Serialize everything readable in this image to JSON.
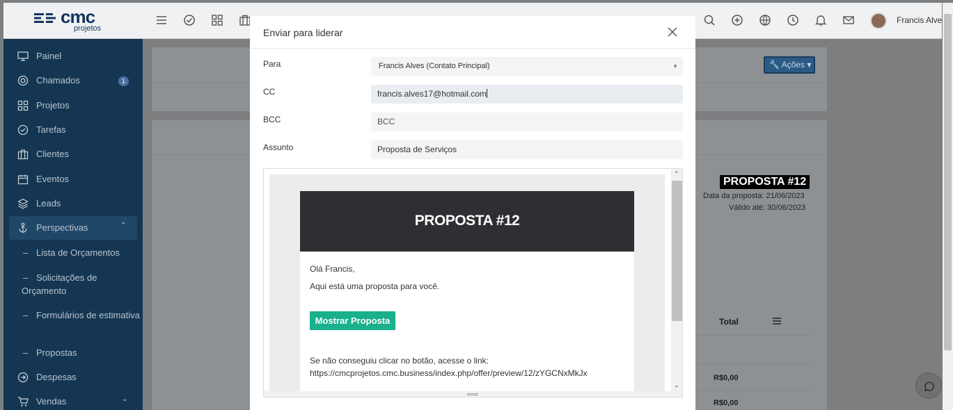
{
  "app": {
    "logo_text": "cmc",
    "logo_sub": "projetos",
    "user_name": "Francis Alves"
  },
  "sidebar": {
    "items": [
      {
        "label": "Painel",
        "icon": "monitor-icon"
      },
      {
        "label": "Chamados",
        "icon": "lifebuoy-icon",
        "badge": "1"
      },
      {
        "label": "Projetos",
        "icon": "grid-icon"
      },
      {
        "label": "Tarefas",
        "icon": "check-circle-icon"
      },
      {
        "label": "Clientes",
        "icon": "briefcase-icon"
      },
      {
        "label": "Eventos",
        "icon": "calendar-icon"
      },
      {
        "label": "Leads",
        "icon": "layers-icon"
      },
      {
        "label": "Perspectivas",
        "icon": "anchor-icon"
      },
      {
        "label": "Despesas",
        "icon": "arrow-right-circle-icon"
      },
      {
        "label": "Vendas",
        "icon": "cart-icon"
      }
    ],
    "sub_items": [
      "Lista de Orçamentos",
      "Solicitações de Orçamento",
      "Formulários de estimativa",
      "Propostas"
    ]
  },
  "background_page": {
    "actions_label": "Ações",
    "doc_title": "PROPOSTA #12",
    "proposal_date": "Data da proposta: 21/06/2023",
    "valid_until": "Válido até: 30/06/2023",
    "total_header": "Total",
    "total_values": [
      "R$0,00",
      "R$0,00"
    ]
  },
  "modal": {
    "title": "Enviar para liderar",
    "to_label": "Para",
    "to_value": "Francis Alves (Contato Principal)",
    "cc_label": "CC",
    "cc_value": "francis.alves17@hotmail.com",
    "bcc_label": "BCC",
    "bcc_placeholder": "BCC",
    "subject_label": "Assunto",
    "subject_value": "Proposta de Serviços",
    "email": {
      "header_title": "PROPOSTA #12",
      "greeting": "Olá Francis,",
      "intro": "Aqui está uma proposta para você.",
      "button_label": "Mostrar Proposta",
      "fallback_text": "Se não conseguiu clicar no botão, acesse o link:",
      "fallback_link": "https://cmcprojetos.cmc.business/index.php/offer/preview/12/zYGCNxMkJx"
    }
  }
}
